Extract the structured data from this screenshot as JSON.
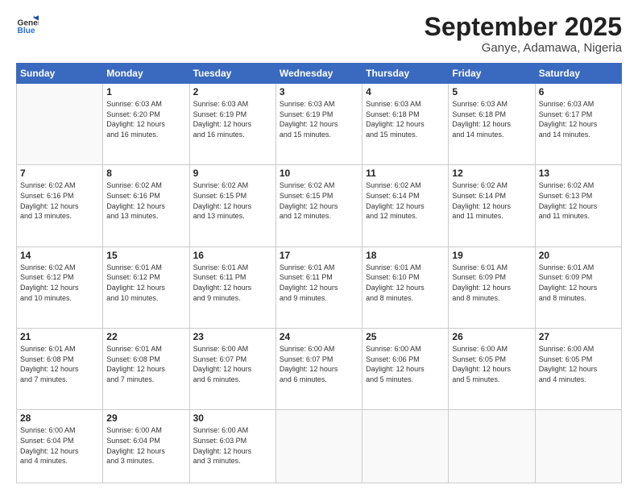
{
  "logo": {
    "general": "General",
    "blue": "Blue"
  },
  "title": {
    "month": "September 2025",
    "location": "Ganye, Adamawa, Nigeria"
  },
  "weekdays": [
    "Sunday",
    "Monday",
    "Tuesday",
    "Wednesday",
    "Thursday",
    "Friday",
    "Saturday"
  ],
  "weeks": [
    [
      {
        "day": "",
        "info": ""
      },
      {
        "day": "1",
        "info": "Sunrise: 6:03 AM\nSunset: 6:20 PM\nDaylight: 12 hours\nand 16 minutes."
      },
      {
        "day": "2",
        "info": "Sunrise: 6:03 AM\nSunset: 6:19 PM\nDaylight: 12 hours\nand 16 minutes."
      },
      {
        "day": "3",
        "info": "Sunrise: 6:03 AM\nSunset: 6:19 PM\nDaylight: 12 hours\nand 15 minutes."
      },
      {
        "day": "4",
        "info": "Sunrise: 6:03 AM\nSunset: 6:18 PM\nDaylight: 12 hours\nand 15 minutes."
      },
      {
        "day": "5",
        "info": "Sunrise: 6:03 AM\nSunset: 6:18 PM\nDaylight: 12 hours\nand 14 minutes."
      },
      {
        "day": "6",
        "info": "Sunrise: 6:03 AM\nSunset: 6:17 PM\nDaylight: 12 hours\nand 14 minutes."
      }
    ],
    [
      {
        "day": "7",
        "info": "Sunrise: 6:02 AM\nSunset: 6:16 PM\nDaylight: 12 hours\nand 13 minutes."
      },
      {
        "day": "8",
        "info": "Sunrise: 6:02 AM\nSunset: 6:16 PM\nDaylight: 12 hours\nand 13 minutes."
      },
      {
        "day": "9",
        "info": "Sunrise: 6:02 AM\nSunset: 6:15 PM\nDaylight: 12 hours\nand 13 minutes."
      },
      {
        "day": "10",
        "info": "Sunrise: 6:02 AM\nSunset: 6:15 PM\nDaylight: 12 hours\nand 12 minutes."
      },
      {
        "day": "11",
        "info": "Sunrise: 6:02 AM\nSunset: 6:14 PM\nDaylight: 12 hours\nand 12 minutes."
      },
      {
        "day": "12",
        "info": "Sunrise: 6:02 AM\nSunset: 6:14 PM\nDaylight: 12 hours\nand 11 minutes."
      },
      {
        "day": "13",
        "info": "Sunrise: 6:02 AM\nSunset: 6:13 PM\nDaylight: 12 hours\nand 11 minutes."
      }
    ],
    [
      {
        "day": "14",
        "info": "Sunrise: 6:02 AM\nSunset: 6:12 PM\nDaylight: 12 hours\nand 10 minutes."
      },
      {
        "day": "15",
        "info": "Sunrise: 6:01 AM\nSunset: 6:12 PM\nDaylight: 12 hours\nand 10 minutes."
      },
      {
        "day": "16",
        "info": "Sunrise: 6:01 AM\nSunset: 6:11 PM\nDaylight: 12 hours\nand 9 minutes."
      },
      {
        "day": "17",
        "info": "Sunrise: 6:01 AM\nSunset: 6:11 PM\nDaylight: 12 hours\nand 9 minutes."
      },
      {
        "day": "18",
        "info": "Sunrise: 6:01 AM\nSunset: 6:10 PM\nDaylight: 12 hours\nand 8 minutes."
      },
      {
        "day": "19",
        "info": "Sunrise: 6:01 AM\nSunset: 6:09 PM\nDaylight: 12 hours\nand 8 minutes."
      },
      {
        "day": "20",
        "info": "Sunrise: 6:01 AM\nSunset: 6:09 PM\nDaylight: 12 hours\nand 8 minutes."
      }
    ],
    [
      {
        "day": "21",
        "info": "Sunrise: 6:01 AM\nSunset: 6:08 PM\nDaylight: 12 hours\nand 7 minutes."
      },
      {
        "day": "22",
        "info": "Sunrise: 6:01 AM\nSunset: 6:08 PM\nDaylight: 12 hours\nand 7 minutes."
      },
      {
        "day": "23",
        "info": "Sunrise: 6:00 AM\nSunset: 6:07 PM\nDaylight: 12 hours\nand 6 minutes."
      },
      {
        "day": "24",
        "info": "Sunrise: 6:00 AM\nSunset: 6:07 PM\nDaylight: 12 hours\nand 6 minutes."
      },
      {
        "day": "25",
        "info": "Sunrise: 6:00 AM\nSunset: 6:06 PM\nDaylight: 12 hours\nand 5 minutes."
      },
      {
        "day": "26",
        "info": "Sunrise: 6:00 AM\nSunset: 6:05 PM\nDaylight: 12 hours\nand 5 minutes."
      },
      {
        "day": "27",
        "info": "Sunrise: 6:00 AM\nSunset: 6:05 PM\nDaylight: 12 hours\nand 4 minutes."
      }
    ],
    [
      {
        "day": "28",
        "info": "Sunrise: 6:00 AM\nSunset: 6:04 PM\nDaylight: 12 hours\nand 4 minutes."
      },
      {
        "day": "29",
        "info": "Sunrise: 6:00 AM\nSunset: 6:04 PM\nDaylight: 12 hours\nand 3 minutes."
      },
      {
        "day": "30",
        "info": "Sunrise: 6:00 AM\nSunset: 6:03 PM\nDaylight: 12 hours\nand 3 minutes."
      },
      {
        "day": "",
        "info": ""
      },
      {
        "day": "",
        "info": ""
      },
      {
        "day": "",
        "info": ""
      },
      {
        "day": "",
        "info": ""
      }
    ]
  ]
}
